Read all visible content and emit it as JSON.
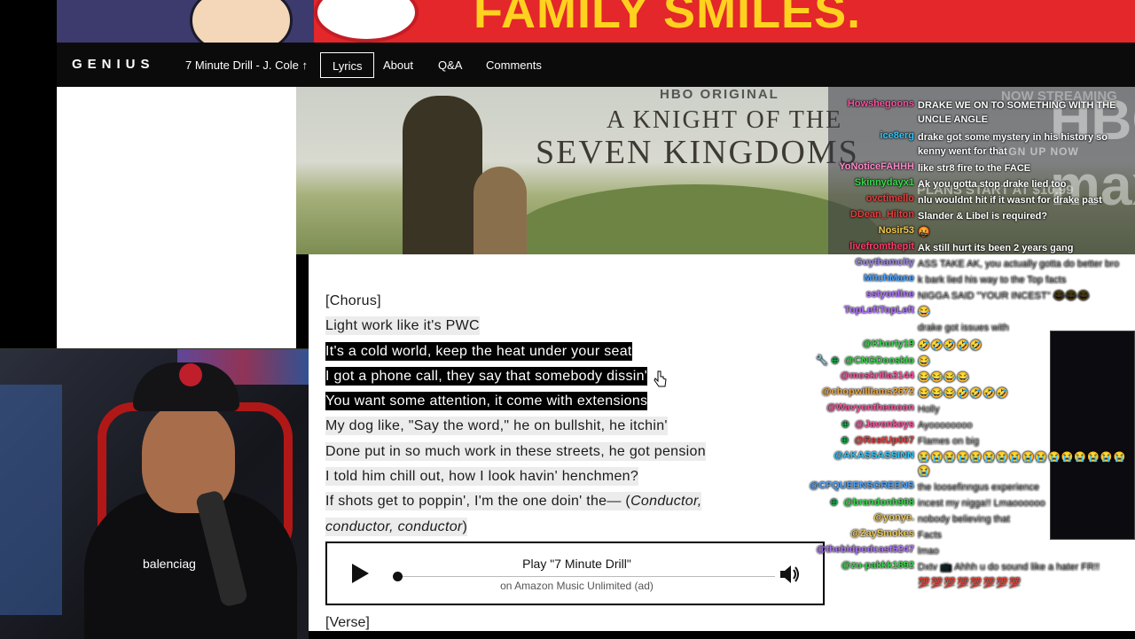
{
  "ads": {
    "top_banner_text": "FAMILY SMILES.",
    "hbo": {
      "label": "HBO ORIGINAL",
      "title_line1": "A KNIGHT OF THE",
      "title_line2": "SEVEN KINGDOMS",
      "streaming": "NOW STREAMING",
      "signup": "SIGN UP NOW",
      "plans": "PLANS START AT $10.99",
      "brand": "HBO max"
    }
  },
  "header": {
    "logo": "GENIUS",
    "song": "7 Minute Drill - J. Cole",
    "tabs": [
      "Lyrics",
      "About",
      "Q&A",
      "Comments"
    ]
  },
  "lyrics": {
    "lines": [
      "[Chorus]",
      "Light work like it's PWC",
      "It's a cold world, keep the heat under your seat",
      "I got a phone call, they say that somebody dissin'",
      "You want some attention, it come with extensions",
      "My dog like, \"Say the word,\" he on bullshit, he itchin'",
      "Done put in so much work in these streets, he got pension",
      "I told him chill out, how I look havin' henchmen?",
      "If shots get to poppin', I'm the one doin' the— (",
      "Conductor,",
      "conductor, conductor",
      ")"
    ],
    "next_section": "[Verse]"
  },
  "player": {
    "title": "Play \"7 Minute Drill\"",
    "subtitle": "on Amazon Music Unlimited (ad)",
    "progress": 0
  },
  "chat": [
    {
      "user": "Howshegoons",
      "color": "#ff4fa0",
      "msg": "DRAKE WE ON TO SOMETHING WITH THE UNCLE ANGLE",
      "style": "normal"
    },
    {
      "user": "ice8erg",
      "color": "#2dc7ff",
      "msg": "drake got some mystery in his history so kenny went for that",
      "style": "normal"
    },
    {
      "user": "YoNoticeFAHHH",
      "color": "#ff8ac9",
      "msg": "like str8 fire to the FACE",
      "style": "normal"
    },
    {
      "user": "Skinnydayx1",
      "color": "#36d84a",
      "msg": "Ak you gotta stop drake lied too",
      "style": "normal"
    },
    {
      "user": "ovctimello",
      "color": "#e53e3e",
      "msg": "nlu wouldnt hit if it wasnt for drake past",
      "style": "normal"
    },
    {
      "user": "DDean_Hilton",
      "color": "#e53e3e",
      "msg": "Slander & Libel is required?",
      "style": "normal"
    },
    {
      "user": "Nosir53",
      "color": "#f2c94c",
      "msg": "🤬",
      "style": "normal"
    },
    {
      "user": "livefromthepit",
      "color": "#ff3a6a",
      "msg": "Ak still hurt its been 2 years gang",
      "style": "normal"
    },
    {
      "user": "Guythamcity",
      "color": "#9b88e0",
      "msg": "ASS TAKE AK, you actually gotta do better bro",
      "style": "dim"
    },
    {
      "user": "MitchMane",
      "color": "#4aa3ff",
      "msg": "k bark lied his way to the Top facts",
      "style": "dim"
    },
    {
      "user": "sstyonline",
      "color": "#b070ff",
      "msg": "NIGGA SAID \"YOUR INCEST\" 😂😂😂",
      "style": "dim"
    },
    {
      "user": "TopLeftTopLeft",
      "color": "#b070ff",
      "msg": "😂",
      "style": "emote"
    },
    {
      "user": "",
      "color": "#ffffff",
      "msg": "drake got issues with",
      "style": "dim"
    },
    {
      "user": "@Khorty19",
      "color": "#36d84a",
      "msg": "🤣🤣🤣🤣🤣",
      "style": "emote"
    },
    {
      "user": "@CNGDooskio",
      "color": "#36d84a",
      "msg": "😂",
      "style": "emote",
      "badge": "🔧 ⊕ "
    },
    {
      "user": "@moskrilla3144",
      "color": "#ff4fa0",
      "msg": "😂😂😂😂",
      "style": "emote"
    },
    {
      "user": "@chopwilliams2672",
      "color": "#f2a93c",
      "msg": "😂😂😂🤣🤣🤣🤣",
      "style": "emote"
    },
    {
      "user": "@Wavyonthemoon",
      "color": "#ff4fa0",
      "msg": "Holly",
      "style": "dim"
    },
    {
      "user": "@Javonkeys",
      "color": "#ff4fa0",
      "msg": "Ayoooooooo",
      "style": "dim",
      "badge": "⊕ "
    },
    {
      "user": "@RestUp007",
      "color": "#e53e3e",
      "msg": "Flames on big",
      "style": "dim",
      "badge": "⊕ "
    },
    {
      "user": "@AKASSASSINN",
      "color": "#2dc7ff",
      "msg": "😭😭😭😭😭😭😭😭😭😭😭😭😭😭😭😭😭",
      "style": "emote"
    },
    {
      "user": "@CFQUEENSGREENS",
      "color": "#4aa3ff",
      "msg": "the loosefinngus experience",
      "style": "dim"
    },
    {
      "user": "@brandonh908",
      "color": "#36d84a",
      "msg": "incest my nigga!! Lmaoooooo",
      "style": "dim",
      "badge": "⊕ "
    },
    {
      "user": "@yonye.",
      "color": "#f2c94c",
      "msg": "nobody believing that",
      "style": "dim"
    },
    {
      "user": "@ZaySmokes",
      "color": "#f2c94c",
      "msg": "Facts",
      "style": "dim"
    },
    {
      "user": "@thebidpodcast5247",
      "color": "#b070ff",
      "msg": "lmao",
      "style": "dim"
    },
    {
      "user": "@zu-pakkk1892",
      "color": "#36d84a",
      "msg": "Dxtv 📺 Ahhh u do sound like a hater FR!!",
      "style": "dim"
    },
    {
      "user": "",
      "color": "#ffffff",
      "msg": "💯💯💯💯💯💯💯💯",
      "style": "emote"
    }
  ],
  "webcam": {
    "shirt_text": "balenciag"
  },
  "colors": {
    "nav_bg": "#0b0b0b",
    "selection_bg": "#000000",
    "lyric_highlight": "#ececec",
    "ad_red": "#e3272a",
    "ad_yellow": "#ffd21f"
  },
  "icons": [
    "play-icon",
    "volume-icon",
    "cursor-icon",
    "external-arrow-icon"
  ]
}
